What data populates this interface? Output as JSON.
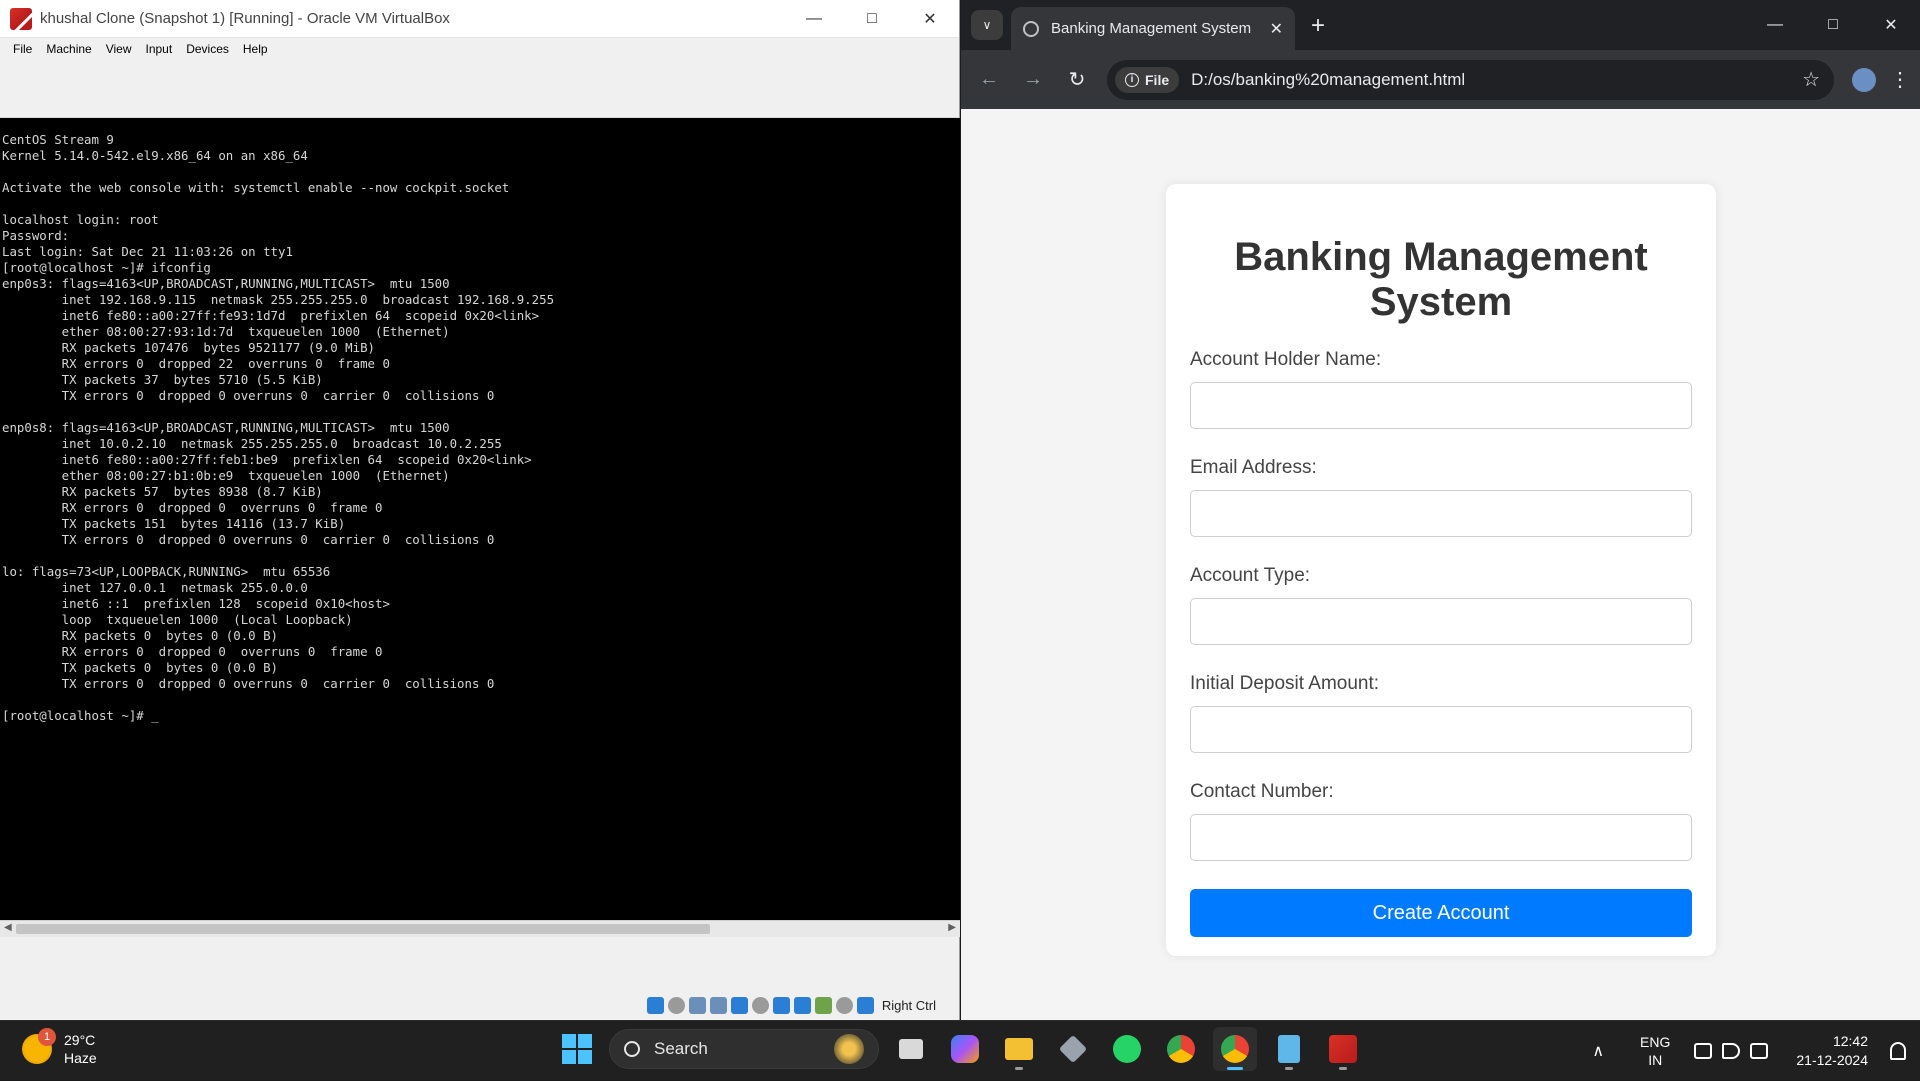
{
  "vbox": {
    "title": "khushal Clone (Snapshot 1) [Running] - Oracle VM VirtualBox",
    "menu": [
      "File",
      "Machine",
      "View",
      "Input",
      "Devices",
      "Help"
    ],
    "terminal": "CentOS Stream 9\nKernel 5.14.0-542.el9.x86_64 on an x86_64\n\nActivate the web console with: systemctl enable --now cockpit.socket\n\nlocalhost login: root\nPassword:\nLast login: Sat Dec 21 11:03:26 on tty1\n[root@localhost ~]# ifconfig\nenp0s3: flags=4163<UP,BROADCAST,RUNNING,MULTICAST>  mtu 1500\n        inet 192.168.9.115  netmask 255.255.255.0  broadcast 192.168.9.255\n        inet6 fe80::a00:27ff:fe93:1d7d  prefixlen 64  scopeid 0x20<link>\n        ether 08:00:27:93:1d:7d  txqueuelen 1000  (Ethernet)\n        RX packets 107476  bytes 9521177 (9.0 MiB)\n        RX errors 0  dropped 22  overruns 0  frame 0\n        TX packets 37  bytes 5710 (5.5 KiB)\n        TX errors 0  dropped 0 overruns 0  carrier 0  collisions 0\n\nenp0s8: flags=4163<UP,BROADCAST,RUNNING,MULTICAST>  mtu 1500\n        inet 10.0.2.10  netmask 255.255.255.0  broadcast 10.0.2.255\n        inet6 fe80::a00:27ff:feb1:be9  prefixlen 64  scopeid 0x20<link>\n        ether 08:00:27:b1:0b:e9  txqueuelen 1000  (Ethernet)\n        RX packets 57  bytes 8938 (8.7 KiB)\n        RX errors 0  dropped 0  overruns 0  frame 0\n        TX packets 151  bytes 14116 (13.7 KiB)\n        TX errors 0  dropped 0 overruns 0  carrier 0  collisions 0\n\nlo: flags=73<UP,LOOPBACK,RUNNING>  mtu 65536\n        inet 127.0.0.1  netmask 255.0.0.0\n        inet6 ::1  prefixlen 128  scopeid 0x10<host>\n        loop  txqueuelen 1000  (Local Loopback)\n        RX packets 0  bytes 0 (0.0 B)\n        RX errors 0  dropped 0  overruns 0  frame 0\n        TX packets 0  bytes 0 (0.0 B)\n        TX errors 0  dropped 0 overruns 0  carrier 0  collisions 0\n\n[root@localhost ~]# _",
    "host_key": "Right Ctrl"
  },
  "chrome": {
    "tab_title": "Banking Management System",
    "site_chip": "File",
    "url": "D:/os/banking%20management.html",
    "page": {
      "heading": "Banking Management System",
      "fields": [
        {
          "label": "Account Holder Name:",
          "value": ""
        },
        {
          "label": "Email Address:",
          "value": ""
        },
        {
          "label": "Account Type:",
          "value": ""
        },
        {
          "label": "Initial Deposit Amount:",
          "value": ""
        },
        {
          "label": "Contact Number:",
          "value": ""
        }
      ],
      "submit_label": "Create Account"
    },
    "accent": "#007bff"
  },
  "taskbar": {
    "weather_temp": "29°C",
    "weather_desc": "Haze",
    "weather_badge": "1",
    "search_label": "Search",
    "lang_1": "ENG",
    "lang_2": "IN",
    "time": "12:42",
    "date": "21-12-2024",
    "apps": [
      "task-view",
      "copilot",
      "file-explorer",
      "virtualbox-manager",
      "whatsapp",
      "chrome",
      "chrome-profile",
      "notepad",
      "virtualbox"
    ]
  }
}
